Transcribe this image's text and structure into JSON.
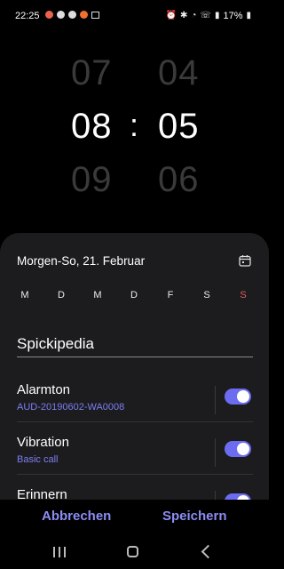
{
  "status_bar": {
    "time": "22:25",
    "battery": "17%",
    "left_icons": [
      "notification-icon-1",
      "notification-icon-2",
      "notification-icon-3",
      "notification-icon-4",
      "gallery-icon"
    ],
    "right_icons": [
      "alarm-icon",
      "bluetooth-icon",
      "wifi-icon",
      "call-icon",
      "signal-icon",
      "battery-icon"
    ]
  },
  "picker": {
    "hours": {
      "prev": "07",
      "current": "08",
      "next": "09"
    },
    "separator": ":",
    "minutes": {
      "prev": "04",
      "current": "05",
      "next": "06"
    }
  },
  "sheet": {
    "date_label": "Morgen-So, 21. Februar",
    "days": [
      {
        "label": "M"
      },
      {
        "label": "D"
      },
      {
        "label": "M"
      },
      {
        "label": "D"
      },
      {
        "label": "F"
      },
      {
        "label": "S"
      },
      {
        "label": "S"
      }
    ],
    "alarm_name": "Spickipedia",
    "settings": [
      {
        "title": "Alarmton",
        "subtitle": "AUD-20190602-WA0008",
        "enabled": true
      },
      {
        "title": "Vibration",
        "subtitle": "Basic call",
        "enabled": true
      },
      {
        "title": "Erinnern",
        "subtitle": "",
        "enabled": true
      }
    ]
  },
  "actions": {
    "cancel_label": "Abbrechen",
    "save_label": "Speichern"
  },
  "colors": {
    "accent": "#6c6cf0",
    "sunday": "#e05a5a",
    "sheet_bg": "#1c1c1e"
  }
}
